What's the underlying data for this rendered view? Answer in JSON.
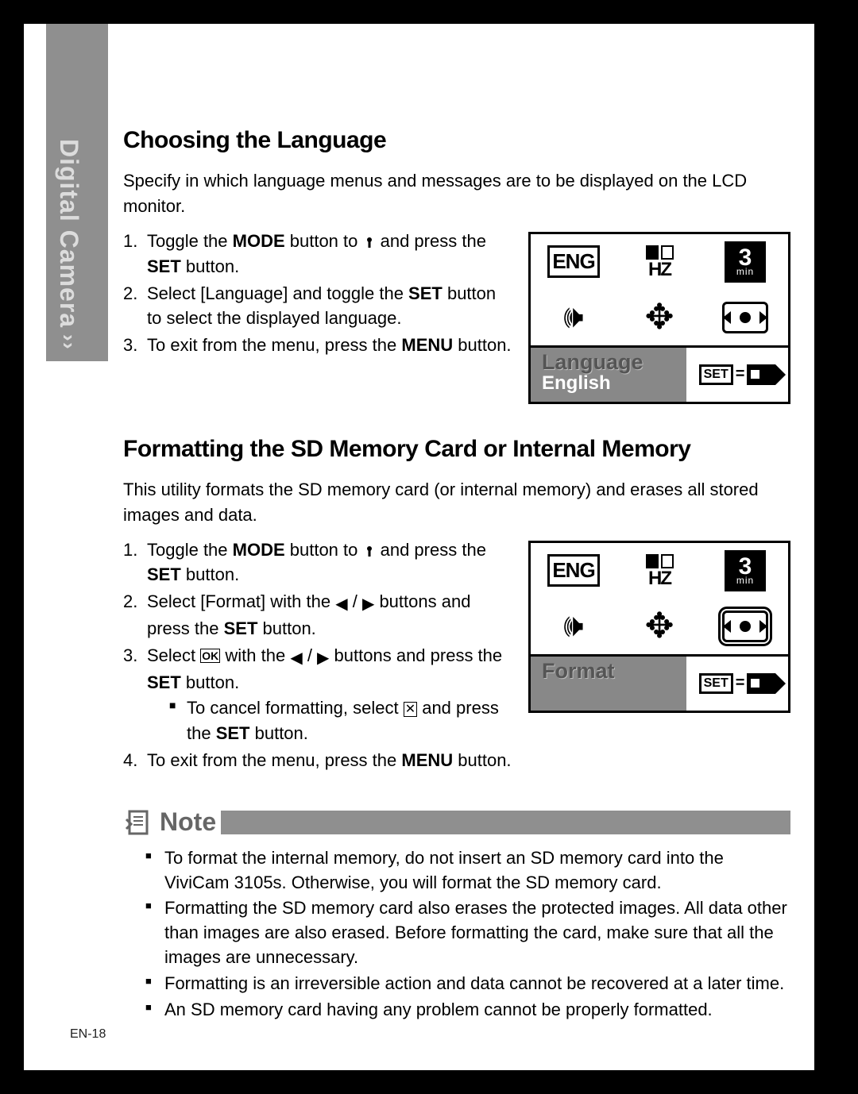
{
  "sidebar": {
    "label": "Digital Camera",
    "chevrons": ">>"
  },
  "pageNumber": "EN-18",
  "section1": {
    "heading": "Choosing the Language",
    "intro": "Specify in which language menus and messages are to be displayed on the LCD monitor.",
    "steps": {
      "s1a": "Toggle the ",
      "s1b": "MODE",
      "s1c": " button to ",
      "s1d": " and press the ",
      "s1e": "SET",
      "s1f": " button.",
      "s2a": "Select [Language] and toggle the ",
      "s2b": "SET",
      "s2c": " button to select the displayed language.",
      "s3a": "To exit from the menu, press the ",
      "s3b": "MENU",
      "s3c": " button."
    },
    "lcd": {
      "title": "Language",
      "value": "English",
      "eng": "ENG",
      "hz": "HZ",
      "minNum": "3",
      "minTxt": "min",
      "set": "SET"
    }
  },
  "section2": {
    "heading": "Formatting the SD Memory Card or Internal Memory",
    "intro": "This utility formats the SD memory card (or internal memory) and erases all stored images and data.",
    "steps": {
      "s1a": "Toggle the ",
      "s1b": "MODE",
      "s1c": " button to ",
      "s1d": " and press the ",
      "s1e": "SET",
      "s1f": " button.",
      "s2a": "Select [Format] with the ",
      "s2b": " / ",
      "s2c": " buttons and press the ",
      "s2d": "SET",
      "s2e": " button.",
      "s3a": "Select ",
      "s3b": " with the ",
      "s3c": " / ",
      "s3d": " buttons and press the ",
      "s3e": "SET",
      "s3f": " button.",
      "sub1a": "To cancel formatting, select ",
      "sub1b": " and press the ",
      "sub1c": "SET",
      "sub1d": " button.",
      "s4a": "To exit from the menu, press the ",
      "s4b": "MENU",
      "s4c": " button."
    },
    "lcd": {
      "title": "Format",
      "value": "",
      "eng": "ENG",
      "hz": "HZ",
      "minNum": "3",
      "minTxt": "min",
      "set": "SET"
    }
  },
  "note": {
    "label": "Note",
    "items": [
      "To format the internal memory, do not insert an SD memory card into the ViviCam 3105s. Otherwise, you will format the SD memory card.",
      "Formatting the SD memory card also erases the protected images. All data other than images are also erased. Before formatting the card, make sure that all the images are unnecessary.",
      "Formatting is an irreversible action and data cannot be recovered at a later time.",
      "An SD memory card having any problem cannot be properly formatted."
    ]
  }
}
